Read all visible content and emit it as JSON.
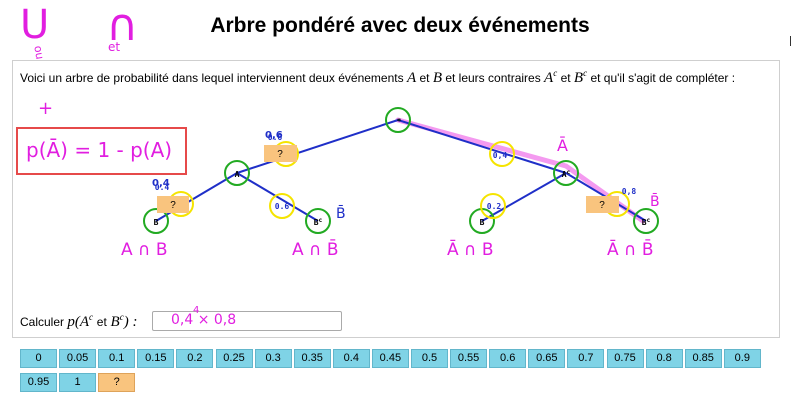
{
  "page": {
    "title": "Arbre pondéré avec deux événements",
    "intro_before": "Voici un arbre de probabilité dans lequel interviennent deux événements",
    "intro_A": "A",
    "intro_and": "et",
    "intro_B": "B",
    "intro_middle": "et leurs contraires",
    "intro_Ac": "A",
    "intro_et2": "et",
    "intro_Bc": "B",
    "intro_after": "et qu'il s'agit de compléter :",
    "sup_c": "c"
  },
  "tree": {
    "root_label": "*",
    "node_A": "A",
    "node_Ac": "A",
    "node_B1": "B",
    "node_Bc1": "B",
    "node_B2": "B",
    "node_Bc2": "B",
    "weight_B_given_A": "0.6",
    "weight_Ac": "0.4",
    "weight_Bc_given_A": "0.6",
    "weight_B_given_Ac": "0.2",
    "box_A": "?",
    "box_B_given_A": "?",
    "box_Bc_given_Ac": "?",
    "colors": {
      "edge": "#1f2fc8",
      "node_ring": "#22aa22",
      "weight_ring": "#f5e400",
      "box": "#f9c47e",
      "highlight": "#f49af0"
    }
  },
  "calc": {
    "label": "Calculer",
    "expr_p": "p(",
    "expr_A": "A",
    "expr_et": "et",
    "expr_B": "B",
    "expr_close": ") :",
    "input_value": ""
  },
  "annotations": {
    "union": "U",
    "intersection": "∩",
    "ou": "ou",
    "et": "et",
    "plus": "+",
    "formula": "p(Ā) = 1 - p(A)",
    "weight_04": "0,4",
    "weight_06": "0,6",
    "weight_Abar": "Ā",
    "weight_08": "0,8",
    "weight_Bbar": "B̄",
    "leaf1": "A ∩ B",
    "leaf2": "A ∩ B̄",
    "leaf3": "Ā ∩ B",
    "leaf4": "Ā ∩ B̄",
    "answer": "0,4 × 0,8",
    "answer_power": "4"
  },
  "tiles": [
    "0",
    "0.05",
    "0.1",
    "0.15",
    "0.2",
    "0.25",
    "0.3",
    "0.35",
    "0.4",
    "0.45",
    "0.5",
    "0.55",
    "0.6",
    "0.65",
    "0.7",
    "0.75",
    "0.8",
    "0.85",
    "0.9",
    "0.95",
    "1",
    "?"
  ]
}
